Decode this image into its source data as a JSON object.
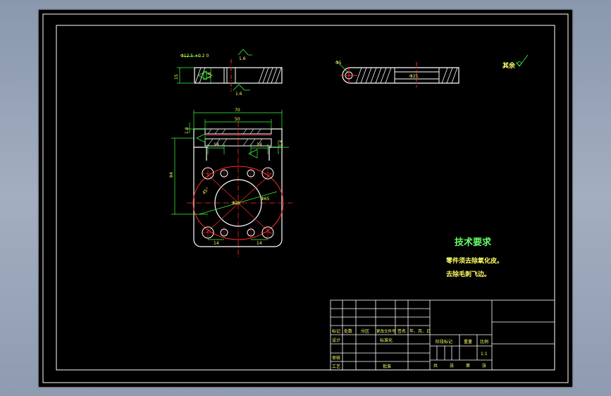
{
  "drawing": {
    "top_view": {
      "diameter_label": "Φ12.5 +0.2 0",
      "thickness_label": "15",
      "depth_label": "1.8",
      "roughness_top": "1.6",
      "roughness_bottom": "1.6"
    },
    "side_view": {
      "diameter_label": "Φ25",
      "hole_label": "Φ5"
    },
    "front_view": {
      "overall_width": "70",
      "inner_width": "50",
      "height_label": "84",
      "top_thickness": "1.8",
      "side_roughness": "1.6",
      "angle_label": "45°",
      "circle_label": "Φ65",
      "inner_circle_label": "Φ25",
      "spacing_labels": [
        "14",
        "14",
        "14",
        "14"
      ]
    },
    "other_roughness": "其余",
    "tech": {
      "title": "技术要求",
      "lines": [
        "零件须去除氧化皮。",
        "去除毛刺飞边。"
      ]
    },
    "title_block": {
      "row_labels": [
        "标记",
        "处数",
        "分区",
        "更改文件号",
        "签名",
        "年、月、日"
      ],
      "design_label": "设计",
      "standard_label": "标准化",
      "review_label": "审核",
      "process_label": "工艺",
      "approve_label": "批准",
      "stage_label": "阶段标记",
      "weight_label": "重量",
      "scale_label": "比例",
      "scale_value": "1:1",
      "sheet_labels": [
        "共",
        "张",
        "第",
        "张"
      ]
    }
  },
  "colors": {
    "line": "#ffffff",
    "center": "#ff2a2a",
    "dim": "#39ff39",
    "text_yellow": "#ffff66",
    "text_green": "#66ff66"
  }
}
